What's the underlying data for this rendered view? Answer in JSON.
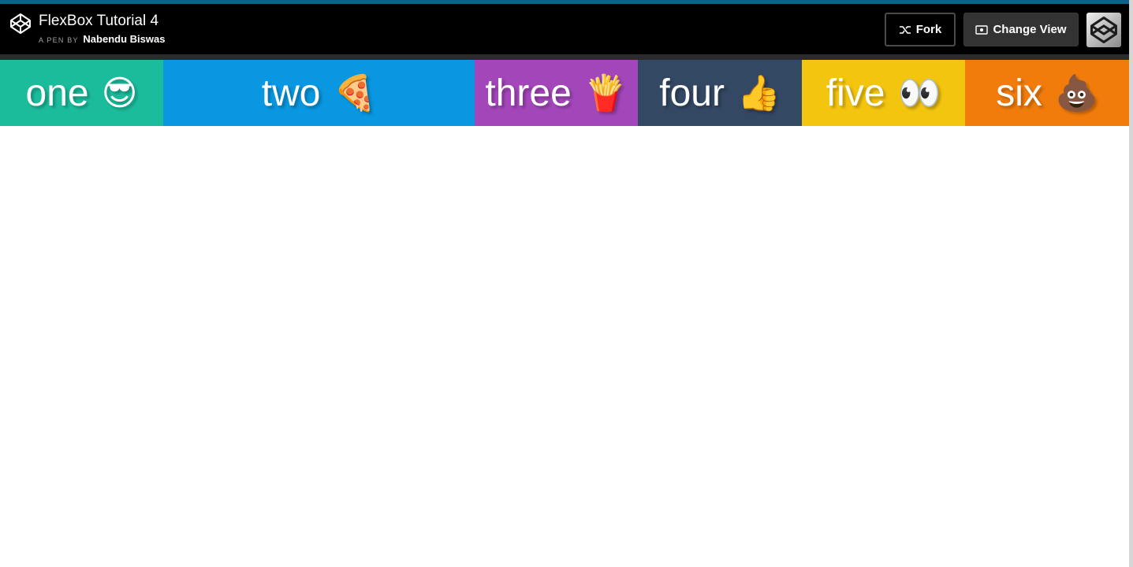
{
  "header": {
    "title": "FlexBox Tutorial 4",
    "byline_prefix": "A PEN BY",
    "author": "Nabendu Biswas",
    "fork_label": "Fork",
    "change_view_label": "Change View",
    "logo_icon": "codepen-logo-icon",
    "avatar_icon": "codepen-avatar-icon"
  },
  "boxes": [
    {
      "label": "one",
      "emoji": "😎",
      "color": "#1abc9c"
    },
    {
      "label": "two",
      "emoji": "🍕",
      "color": "#0897e0"
    },
    {
      "label": "three",
      "emoji": "🍟",
      "color": "#a346ba"
    },
    {
      "label": "four",
      "emoji": "👍",
      "color": "#334863"
    },
    {
      "label": "five",
      "emoji": "👀",
      "color": "#f4c50f"
    },
    {
      "label": "six",
      "emoji": "💩",
      "color": "#f17c0c"
    }
  ],
  "colors": {
    "header_bg": "#000000",
    "accent": "#11608a"
  }
}
